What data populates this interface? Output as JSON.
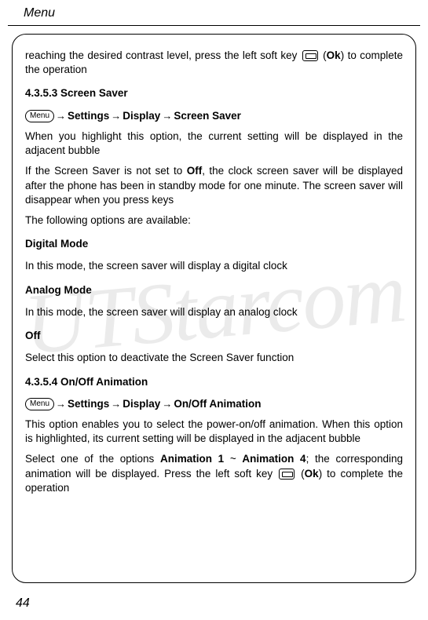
{
  "header": "Menu",
  "watermark": "UTStarcom",
  "para1_prefix": "reaching the desired contrast level, press the left soft key ",
  "para1_suffix": " (",
  "para1_ok": "Ok",
  "para1_end": ") to complete the operation",
  "section1_heading": "4.3.5.3 Screen Saver",
  "nav1_menu": "Menu",
  "nav1_seg1": "Settings",
  "nav1_seg2": "Display",
  "nav1_seg3": "Screen Saver",
  "para2": "When you highlight this option, the current setting will be displayed in the adjacent bubble",
  "para3_prefix": "If the Screen Saver is not set to ",
  "para3_bold": "Off",
  "para3_suffix": ", the clock screen saver will be displayed after the phone has been in standby mode for one minute. The screen saver will disappear when you press keys",
  "para4": "The following options are available:",
  "sub1": "Digital Mode",
  "sub1_text": "In this mode, the screen saver will display a digital clock",
  "sub2": "Analog Mode",
  "sub2_text": "In this mode, the screen saver will display an analog clock",
  "sub3": "Off",
  "sub3_text": "Select this option to deactivate the Screen Saver function",
  "section2_heading": "4.3.5.4 On/Off Animation",
  "nav2_menu": "Menu",
  "nav2_seg1": "Settings",
  "nav2_seg2": "Display",
  "nav2_seg3": "On/Off Animation",
  "para5": "This option enables you to select the power-on/off animation. When this option is highlighted, its current setting will be displayed in the adjacent bubble",
  "para6_prefix": "Select one of the options ",
  "para6_bold1": "Animation 1",
  "para6_mid": " ~ ",
  "para6_bold2": "Animation 4",
  "para6_suffix1": "; the corresponding animation will be displayed. Press the left soft key ",
  "para6_open": " (",
  "para6_ok": "Ok",
  "para6_close": ") to complete the operation",
  "page_number": "44"
}
